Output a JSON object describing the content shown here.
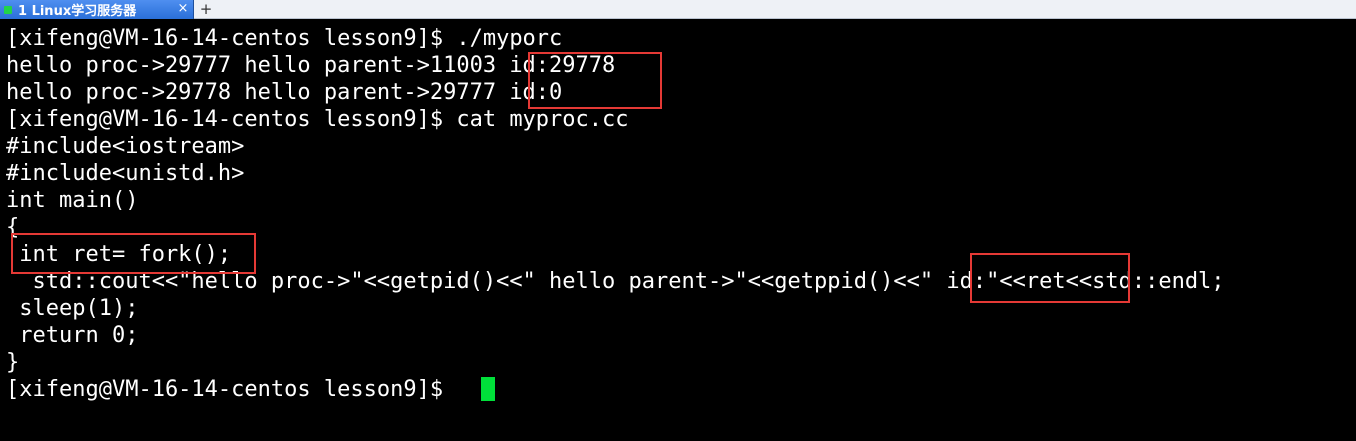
{
  "tab": {
    "label": "1 Linux学习服务器",
    "close": "×",
    "add": "+"
  },
  "terminal": {
    "lines": [
      "[xifeng@VM-16-14-centos lesson9]$ ./myporc",
      "hello proc->29777 hello parent->11003 id:29778",
      "hello proc->29778 hello parent->29777 id:0",
      "[xifeng@VM-16-14-centos lesson9]$ cat myproc.cc",
      "#include<iostream>",
      "#include<unistd.h>",
      "int main()",
      "{",
      " int ret= fork();",
      "  std::cout<<\"hello proc->\"<<getpid()<<\" hello parent->\"<<getppid()<<\" id:\"<<ret<<std::endl;",
      " sleep(1);",
      " return 0;",
      "}",
      "[xifeng@VM-16-14-centos lesson9]$ "
    ]
  },
  "colors": {
    "background": "#000000",
    "text": "#ffffff",
    "highlight_box": "#e53935",
    "cursor": "#00e03a",
    "tab_active": "#2a6fd8"
  }
}
